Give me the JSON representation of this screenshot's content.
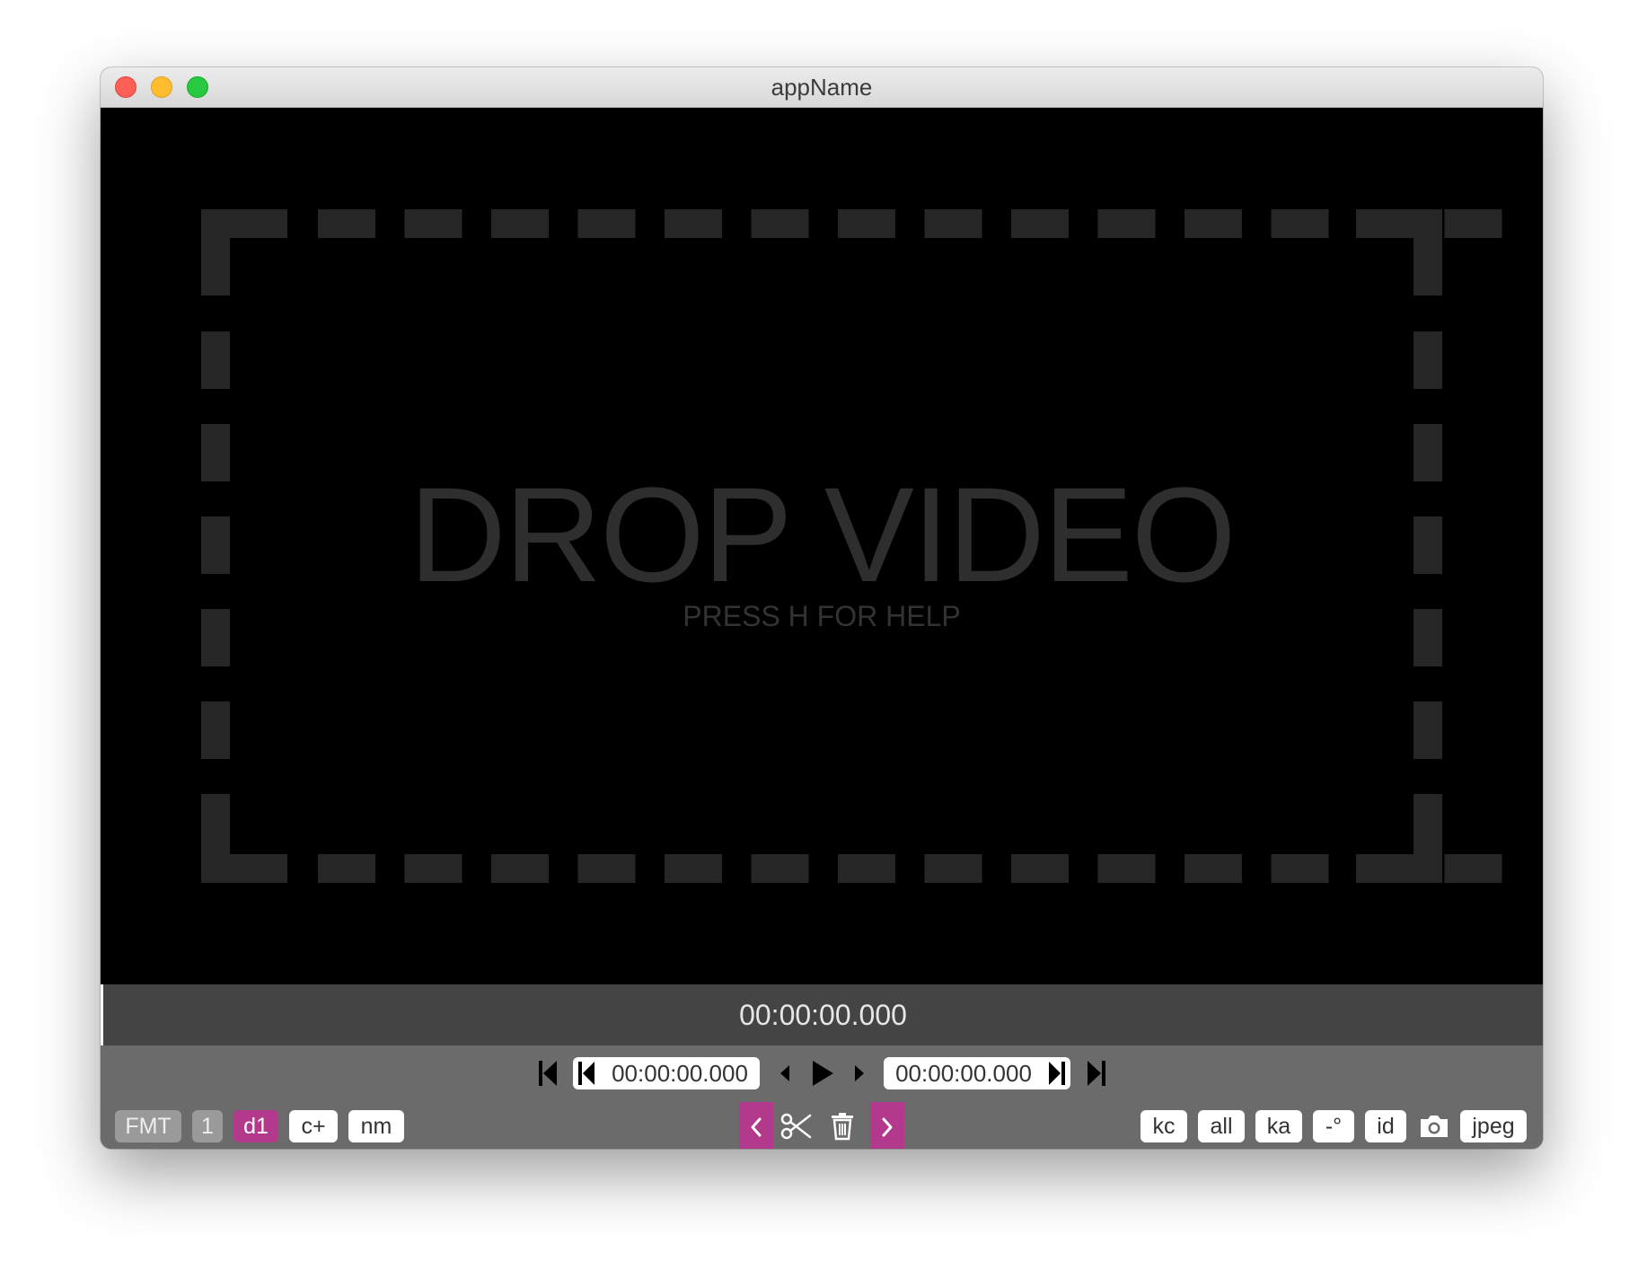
{
  "window": {
    "title": "appName"
  },
  "drop_zone": {
    "title": "DROP VIDEO",
    "subtitle": "PRESS H FOR HELP"
  },
  "timeline": {
    "current_time": "00:00:00.000"
  },
  "transport": {
    "cut_start_time": "00:00:00.000",
    "cut_end_time": "00:00:00.000"
  },
  "left_buttons": {
    "format": "FMT",
    "one": "1",
    "d1": "d1",
    "c_plus": "c+",
    "nm": "nm"
  },
  "right_buttons": {
    "kc": "kc",
    "all": "all",
    "ka": "ka",
    "rotate": "-°",
    "id": "id",
    "jpeg": "jpeg"
  },
  "colors": {
    "accent": "#b2398b",
    "video_bg": "#000000",
    "toolbar_bg": "#6b6b6b",
    "timebar_bg": "#444444",
    "dashed_frame": "#262626"
  },
  "icons": {
    "jump_start": "jump-to-start-icon",
    "set_cut_start": "set-cut-start-icon",
    "step_back": "step-back-icon",
    "play": "play-icon",
    "step_forward": "step-forward-icon",
    "set_cut_end": "set-cut-end-icon",
    "jump_end": "jump-to-end-icon",
    "prev_segment": "chevron-left-icon",
    "cut": "scissors-icon",
    "delete": "trash-icon",
    "next_segment": "chevron-right-icon",
    "screenshot": "camera-icon"
  }
}
